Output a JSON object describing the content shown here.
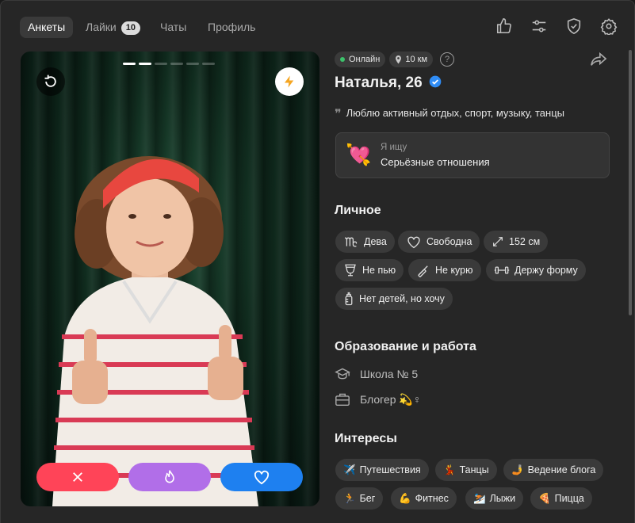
{
  "nav": {
    "tabs": [
      {
        "label": "Анкеты"
      },
      {
        "label": "Лайки",
        "badge": "10"
      },
      {
        "label": "Чаты"
      },
      {
        "label": "Профиль"
      }
    ],
    "icons": [
      "thumbs-up-icon",
      "sliders-icon",
      "shield-check-icon",
      "gear-icon"
    ]
  },
  "photo": {
    "total_photos": 6,
    "current_photo": 2
  },
  "actions": {
    "dislike_color": "#ff4458",
    "superlike_color": "#b16ee8",
    "like_color": "#1e80f0"
  },
  "profile": {
    "status": "Онлайн",
    "distance": "10 км",
    "help": "?",
    "name": "Наталья, 26",
    "quote_mark": "❞",
    "quote": "Люблю активный отдых, спорт, музыку, танцы",
    "looking_label": "Я ищу",
    "looking_value": "Серьёзные отношения",
    "looking_emoji": "💘"
  },
  "personal": {
    "title": "Личное",
    "items": [
      {
        "label": "Дева",
        "icon": "virgo-icon"
      },
      {
        "label": "Свободна",
        "icon": "heart-outline-icon"
      },
      {
        "label": "152 см",
        "icon": "height-icon"
      },
      {
        "label": "Не пью",
        "icon": "glass-icon"
      },
      {
        "label": "Не курю",
        "icon": "no-smoking-icon"
      },
      {
        "label": "Держу форму",
        "icon": "dumbbell-icon"
      },
      {
        "label": "Нет детей, но хочу",
        "icon": "baby-bottle-icon"
      }
    ]
  },
  "education": {
    "title": "Образование и работа",
    "school": "Школа № 5",
    "job": "Блогер 💫♀"
  },
  "interests": {
    "title": "Интересы",
    "items": [
      {
        "emoji": "✈️",
        "label": "Путешествия"
      },
      {
        "emoji": "💃",
        "label": "Танцы"
      },
      {
        "emoji": "🤳",
        "label": "Ведение блога"
      },
      {
        "emoji": "🏃",
        "label": "Бег"
      },
      {
        "emoji": "💪",
        "label": "Фитнес"
      },
      {
        "emoji": "⛷️",
        "label": "Лыжи"
      },
      {
        "emoji": "🍕",
        "label": "Пицца"
      }
    ]
  }
}
